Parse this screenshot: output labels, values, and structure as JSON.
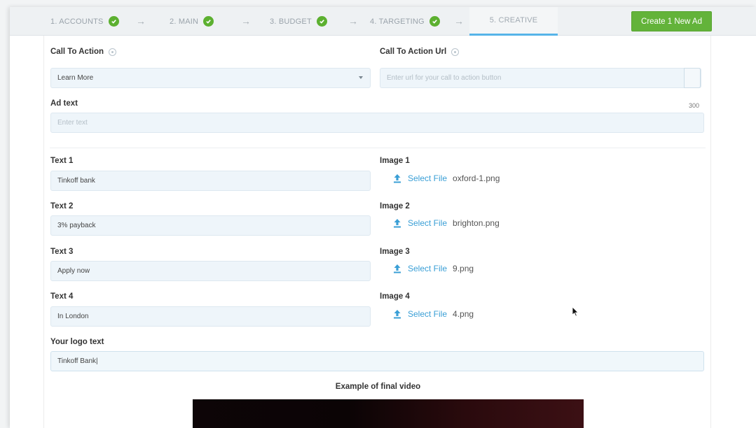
{
  "wizard": {
    "steps": [
      {
        "label": "1. ACCOUNTS",
        "done": true
      },
      {
        "label": "2. MAIN",
        "done": true
      },
      {
        "label": "3. BUDGET",
        "done": true
      },
      {
        "label": "4. TARGETING",
        "done": true
      },
      {
        "label": "5. CREATIVE",
        "done": false,
        "active": true
      }
    ],
    "create_button": "Create 1 New Ad"
  },
  "form": {
    "call_to_action": {
      "label": "Call To Action",
      "value": "Learn More"
    },
    "call_to_action_url": {
      "label": "Call To Action Url",
      "placeholder": "Enter url for your call to action button"
    },
    "ad_text": {
      "label": "Ad text",
      "placeholder": "Enter text",
      "counter": "300"
    },
    "texts": [
      {
        "label": "Text 1",
        "value": "Tinkoff bank"
      },
      {
        "label": "Text 2",
        "value": "3% payback"
      },
      {
        "label": "Text 3",
        "value": "Apply now"
      },
      {
        "label": "Text 4",
        "value": "In London"
      }
    ],
    "images": [
      {
        "label": "Image 1",
        "action": "Select File",
        "file": "oxford-1.png"
      },
      {
        "label": "Image 2",
        "action": "Select File",
        "file": "brighton.png"
      },
      {
        "label": "Image 3",
        "action": "Select File",
        "file": "9.png"
      },
      {
        "label": "Image 4",
        "action": "Select File",
        "file": "4.png"
      }
    ],
    "logo_text": {
      "label": "Your logo text",
      "value": "Tinkoff Bank|"
    }
  },
  "preview": {
    "title": "Example of final video"
  },
  "colors": {
    "accent": "#3a9fd6",
    "success": "#5cb030",
    "button": "#63b33a"
  }
}
